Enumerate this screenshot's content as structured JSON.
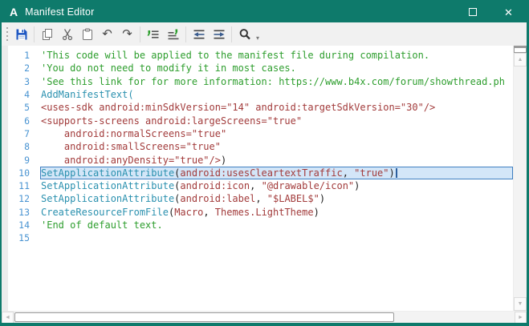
{
  "window": {
    "title": "Manifest Editor",
    "logo_letter": "A"
  },
  "colors": {
    "chrome": "#0e7a6b",
    "toolbar_bg": "#f1f1f1",
    "editor_bg": "#ffffff",
    "gutter_bg": "#ececec",
    "line_number": "#4a94d2",
    "comment": "#2e9e2e",
    "keyword": "#2b91af",
    "literal": "#a23b3b",
    "plain": "#202020",
    "selection_bg": "#d3e6f8",
    "selection_border": "#3f7fc1",
    "caret": "#2b5f9e",
    "scrollbar_track": "#f3f3f3",
    "scrollbar_glyph": "#b5b5b5"
  },
  "icons": {
    "undo": "↶",
    "redo": "↷",
    "overflow": "▾",
    "up": "▲",
    "down": "▼",
    "left": "◄",
    "right": "►",
    "close": "✕"
  },
  "toolbar": {
    "buttons": [
      "save",
      "copy",
      "cut",
      "paste",
      "undo",
      "redo",
      "comment",
      "uncomment",
      "outdent",
      "indent",
      "search"
    ]
  },
  "editor": {
    "selected_line": 10,
    "lines": [
      {
        "n": 1,
        "segments": [
          {
            "style": "comment",
            "text": "'This code will be applied to the manifest file during compilation."
          }
        ]
      },
      {
        "n": 2,
        "segments": [
          {
            "style": "comment",
            "text": "'You do not need to modify it in most cases."
          }
        ]
      },
      {
        "n": 3,
        "segments": [
          {
            "style": "comment",
            "text": "'See this link for for more information: https://www.b4x.com/forum/showthread.ph"
          }
        ]
      },
      {
        "n": 4,
        "segments": [
          {
            "style": "keyword",
            "text": "AddManifestText("
          }
        ]
      },
      {
        "n": 5,
        "segments": [
          {
            "style": "xml",
            "text": "<uses-sdk android:minSdkVersion=\"14\" android:targetSdkVersion=\"30\"/>"
          }
        ]
      },
      {
        "n": 6,
        "segments": [
          {
            "style": "xml",
            "text": "<supports-screens android:largeScreens=\"true\""
          }
        ]
      },
      {
        "n": 7,
        "segments": [
          {
            "style": "xml",
            "text": "    android:normalScreens=\"true\""
          }
        ]
      },
      {
        "n": 8,
        "segments": [
          {
            "style": "xml",
            "text": "    android:smallScreens=\"true\""
          }
        ]
      },
      {
        "n": 9,
        "segments": [
          {
            "style": "xml",
            "text": "    android:anyDensity=\"true\"/>"
          },
          {
            "style": "plain",
            "text": ")"
          }
        ]
      },
      {
        "n": 10,
        "segments": [
          {
            "style": "keyword",
            "text": "SetApplicationAttribute"
          },
          {
            "style": "plain",
            "text": "("
          },
          {
            "style": "xml",
            "text": "android:usesCleartextTraffic"
          },
          {
            "style": "plain",
            "text": ", "
          },
          {
            "style": "xml",
            "text": "\"true\""
          },
          {
            "style": "plain",
            "text": ")"
          }
        ]
      },
      {
        "n": 11,
        "segments": [
          {
            "style": "keyword",
            "text": "SetApplicationAttribute"
          },
          {
            "style": "plain",
            "text": "("
          },
          {
            "style": "xml",
            "text": "android:icon"
          },
          {
            "style": "plain",
            "text": ", "
          },
          {
            "style": "xml",
            "text": "\"@drawable/icon\""
          },
          {
            "style": "plain",
            "text": ")"
          }
        ]
      },
      {
        "n": 12,
        "segments": [
          {
            "style": "keyword",
            "text": "SetApplicationAttribute"
          },
          {
            "style": "plain",
            "text": "("
          },
          {
            "style": "xml",
            "text": "android:label"
          },
          {
            "style": "plain",
            "text": ", "
          },
          {
            "style": "xml",
            "text": "\"$LABEL$\""
          },
          {
            "style": "plain",
            "text": ")"
          }
        ]
      },
      {
        "n": 13,
        "segments": [
          {
            "style": "keyword",
            "text": "CreateResourceFromFile"
          },
          {
            "style": "plain",
            "text": "("
          },
          {
            "style": "xml",
            "text": "Macro"
          },
          {
            "style": "plain",
            "text": ", "
          },
          {
            "style": "xml",
            "text": "Themes.LightTheme"
          },
          {
            "style": "plain",
            "text": ")"
          }
        ]
      },
      {
        "n": 14,
        "segments": [
          {
            "style": "comment",
            "text": "'End of default text."
          }
        ]
      },
      {
        "n": 15,
        "segments": []
      }
    ]
  }
}
